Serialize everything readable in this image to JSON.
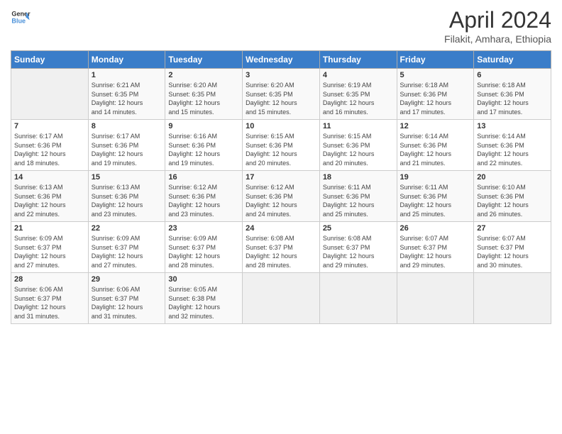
{
  "logo": {
    "line1": "General",
    "line2": "Blue"
  },
  "title": "April 2024",
  "subtitle": "Filakit, Amhara, Ethiopia",
  "days_of_week": [
    "Sunday",
    "Monday",
    "Tuesday",
    "Wednesday",
    "Thursday",
    "Friday",
    "Saturday"
  ],
  "weeks": [
    [
      {
        "num": "",
        "info": ""
      },
      {
        "num": "1",
        "info": "Sunrise: 6:21 AM\nSunset: 6:35 PM\nDaylight: 12 hours\nand 14 minutes."
      },
      {
        "num": "2",
        "info": "Sunrise: 6:20 AM\nSunset: 6:35 PM\nDaylight: 12 hours\nand 15 minutes."
      },
      {
        "num": "3",
        "info": "Sunrise: 6:20 AM\nSunset: 6:35 PM\nDaylight: 12 hours\nand 15 minutes."
      },
      {
        "num": "4",
        "info": "Sunrise: 6:19 AM\nSunset: 6:35 PM\nDaylight: 12 hours\nand 16 minutes."
      },
      {
        "num": "5",
        "info": "Sunrise: 6:18 AM\nSunset: 6:36 PM\nDaylight: 12 hours\nand 17 minutes."
      },
      {
        "num": "6",
        "info": "Sunrise: 6:18 AM\nSunset: 6:36 PM\nDaylight: 12 hours\nand 17 minutes."
      }
    ],
    [
      {
        "num": "7",
        "info": "Sunrise: 6:17 AM\nSunset: 6:36 PM\nDaylight: 12 hours\nand 18 minutes."
      },
      {
        "num": "8",
        "info": "Sunrise: 6:17 AM\nSunset: 6:36 PM\nDaylight: 12 hours\nand 19 minutes."
      },
      {
        "num": "9",
        "info": "Sunrise: 6:16 AM\nSunset: 6:36 PM\nDaylight: 12 hours\nand 19 minutes."
      },
      {
        "num": "10",
        "info": "Sunrise: 6:15 AM\nSunset: 6:36 PM\nDaylight: 12 hours\nand 20 minutes."
      },
      {
        "num": "11",
        "info": "Sunrise: 6:15 AM\nSunset: 6:36 PM\nDaylight: 12 hours\nand 20 minutes."
      },
      {
        "num": "12",
        "info": "Sunrise: 6:14 AM\nSunset: 6:36 PM\nDaylight: 12 hours\nand 21 minutes."
      },
      {
        "num": "13",
        "info": "Sunrise: 6:14 AM\nSunset: 6:36 PM\nDaylight: 12 hours\nand 22 minutes."
      }
    ],
    [
      {
        "num": "14",
        "info": "Sunrise: 6:13 AM\nSunset: 6:36 PM\nDaylight: 12 hours\nand 22 minutes."
      },
      {
        "num": "15",
        "info": "Sunrise: 6:13 AM\nSunset: 6:36 PM\nDaylight: 12 hours\nand 23 minutes."
      },
      {
        "num": "16",
        "info": "Sunrise: 6:12 AM\nSunset: 6:36 PM\nDaylight: 12 hours\nand 23 minutes."
      },
      {
        "num": "17",
        "info": "Sunrise: 6:12 AM\nSunset: 6:36 PM\nDaylight: 12 hours\nand 24 minutes."
      },
      {
        "num": "18",
        "info": "Sunrise: 6:11 AM\nSunset: 6:36 PM\nDaylight: 12 hours\nand 25 minutes."
      },
      {
        "num": "19",
        "info": "Sunrise: 6:11 AM\nSunset: 6:36 PM\nDaylight: 12 hours\nand 25 minutes."
      },
      {
        "num": "20",
        "info": "Sunrise: 6:10 AM\nSunset: 6:36 PM\nDaylight: 12 hours\nand 26 minutes."
      }
    ],
    [
      {
        "num": "21",
        "info": "Sunrise: 6:09 AM\nSunset: 6:37 PM\nDaylight: 12 hours\nand 27 minutes."
      },
      {
        "num": "22",
        "info": "Sunrise: 6:09 AM\nSunset: 6:37 PM\nDaylight: 12 hours\nand 27 minutes."
      },
      {
        "num": "23",
        "info": "Sunrise: 6:09 AM\nSunset: 6:37 PM\nDaylight: 12 hours\nand 28 minutes."
      },
      {
        "num": "24",
        "info": "Sunrise: 6:08 AM\nSunset: 6:37 PM\nDaylight: 12 hours\nand 28 minutes."
      },
      {
        "num": "25",
        "info": "Sunrise: 6:08 AM\nSunset: 6:37 PM\nDaylight: 12 hours\nand 29 minutes."
      },
      {
        "num": "26",
        "info": "Sunrise: 6:07 AM\nSunset: 6:37 PM\nDaylight: 12 hours\nand 29 minutes."
      },
      {
        "num": "27",
        "info": "Sunrise: 6:07 AM\nSunset: 6:37 PM\nDaylight: 12 hours\nand 30 minutes."
      }
    ],
    [
      {
        "num": "28",
        "info": "Sunrise: 6:06 AM\nSunset: 6:37 PM\nDaylight: 12 hours\nand 31 minutes."
      },
      {
        "num": "29",
        "info": "Sunrise: 6:06 AM\nSunset: 6:37 PM\nDaylight: 12 hours\nand 31 minutes."
      },
      {
        "num": "30",
        "info": "Sunrise: 6:05 AM\nSunset: 6:38 PM\nDaylight: 12 hours\nand 32 minutes."
      },
      {
        "num": "",
        "info": ""
      },
      {
        "num": "",
        "info": ""
      },
      {
        "num": "",
        "info": ""
      },
      {
        "num": "",
        "info": ""
      }
    ]
  ]
}
